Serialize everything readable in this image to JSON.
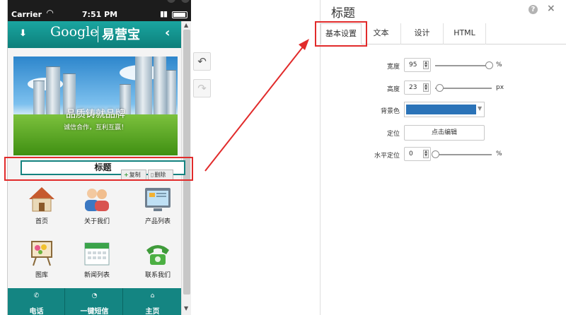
{
  "status_bar": {
    "carrier": "Carrier",
    "time": "7:51 PM"
  },
  "phone_header": {
    "brand_en": "Google",
    "brand_cn": "易营宝"
  },
  "banner": {
    "slogan": "品质铸就品牌",
    "sub": "诚信合作，互利互赢！"
  },
  "title_block": {
    "text": "标题",
    "copy_label": "复制",
    "delete_label": "删除"
  },
  "grid": [
    {
      "label": "首页",
      "icon": "house-icon"
    },
    {
      "label": "关于我们",
      "icon": "people-icon"
    },
    {
      "label": "产品列表",
      "icon": "product-list-icon"
    },
    {
      "label": "图库",
      "icon": "gallery-icon"
    },
    {
      "label": "新闻列表",
      "icon": "calendar-icon"
    },
    {
      "label": "联系我们",
      "icon": "telephone-icon"
    }
  ],
  "tab_bar": [
    {
      "label": "电话",
      "icon": "phone-icon"
    },
    {
      "label": "一键短信",
      "icon": "sms-icon"
    },
    {
      "label": "主页",
      "icon": "home-icon"
    }
  ],
  "panel": {
    "title": "标题",
    "tabs": [
      "基本设置",
      "文本",
      "设计",
      "HTML"
    ],
    "active_tab": 0,
    "fields": {
      "width": {
        "label": "宽度",
        "value": "95",
        "unit": "%",
        "level_percent": 95
      },
      "height": {
        "label": "高度",
        "value": "23",
        "unit": "px",
        "level_percent": 8
      },
      "bg_color": {
        "label": "背景色",
        "color": "#2b73b8"
      },
      "position": {
        "label": "定位",
        "button": "点击编辑"
      },
      "h_offset": {
        "label": "水平定位",
        "value": "0",
        "unit": "%",
        "level_percent": 0
      }
    }
  },
  "colors": {
    "teal": "#148582",
    "highlight_red": "#e12b2b",
    "bg_blue": "#2b73b8"
  }
}
